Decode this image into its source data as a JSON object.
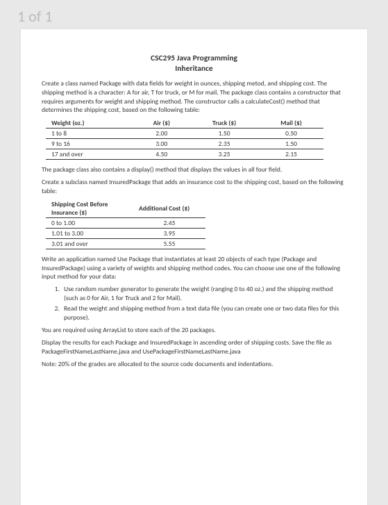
{
  "page_indicator": "1 of 1",
  "title": "CSC295 Java Programming",
  "subtitle": "Inheritance",
  "p1": "Create a class named Package with data fields for weight in ounces, shipping metod, and shipping cost. The shipping method is a character: A for air, T for truck, or M for mail. The package class contains a constructor that requires arguments for weight and shipping method. The constructor calls a calculateCost() method that determines the shipping cost, based on the following table:",
  "table1": {
    "headers": [
      "Weight (oz.)",
      "Air ($)",
      "Truck ($)",
      "Mail ($)"
    ],
    "rows": [
      [
        "1 to 8",
        "2.00",
        "1.50",
        "0.50"
      ],
      [
        "9 to 16",
        "3.00",
        "2.35",
        "1.50"
      ],
      [
        "17 and over",
        "4.50",
        "3.25",
        "2.15"
      ]
    ]
  },
  "p2": "The package class also contains a display() method that displays the values in all four field.",
  "p3": "Create a subclass named InsuredPackage that adds an insurance cost to the shipping cost, based on the following table:",
  "table2": {
    "headers": [
      "Shipping Cost Before Insurance  ($)",
      "Additional Cost ($)"
    ],
    "rows": [
      [
        "0 to 1.00",
        "2.45"
      ],
      [
        "1.01 to 3.00",
        "3.95"
      ],
      [
        "3.01 and over",
        "5.55"
      ]
    ]
  },
  "p4": "Write an application named Use Package that instantiates at least 20 objects of each type (Package and InsuredPackage) using a variety of weights and shipping method codes. You can choose use one of the following input method for your data:",
  "list": [
    "Use random number generator to generate the weight (ranging 0 to 40 oz.) and the shipping method (such as 0 for Air, 1 for Truck and 2 for Mail).",
    "Read the weight and shipping method from a text data file (you can create one or two data files for this purpose)."
  ],
  "p5": "You are required using ArrayList to store each of the 20 packages.",
  "p6": "Display the results for each Package and InsuredPackage in ascending order of shipping costs. Save the file as PackageFirstNameLastName.java and UsePackageFirstNameLastName.java",
  "p7": "Note: 20% of the grades are allocated to the source code documents and indentations."
}
